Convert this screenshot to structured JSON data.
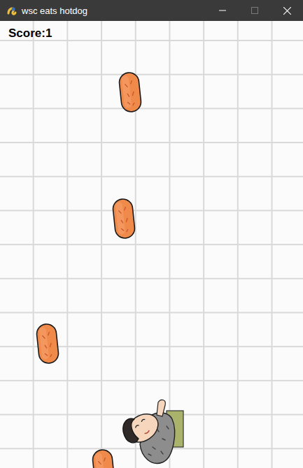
{
  "window": {
    "title": "wsc eats hotdog"
  },
  "hud": {
    "score": "Score:1"
  },
  "sprites": [
    {
      "kind": "hotdog"
    },
    {
      "kind": "hotdog"
    },
    {
      "kind": "hotdog"
    },
    {
      "kind": "hotdog"
    },
    {
      "kind": "player"
    }
  ]
}
